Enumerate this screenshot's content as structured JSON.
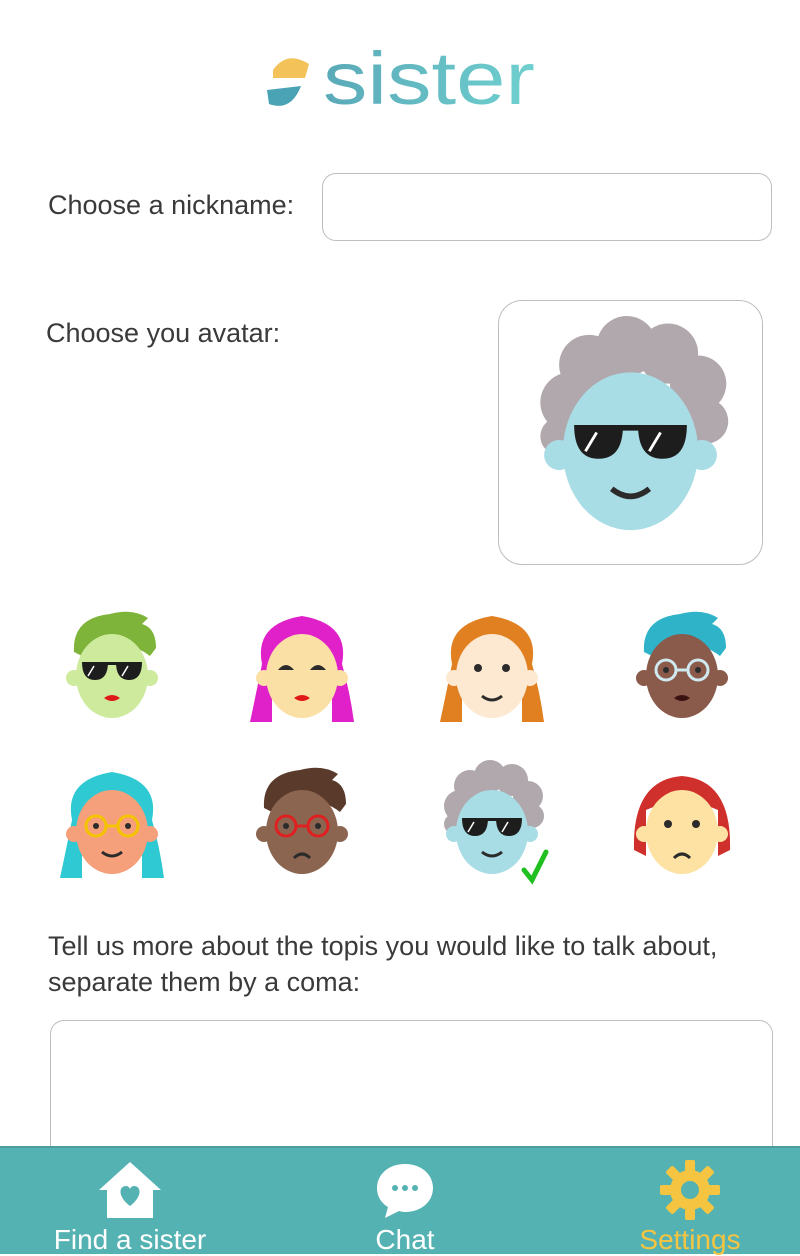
{
  "app": {
    "logo_text": "sister"
  },
  "form": {
    "nickname_label": "Choose a nickname:",
    "nickname_value": "",
    "avatar_label": "Choose you avatar:",
    "selected_avatar": "avatar-7",
    "topics_label": "Tell us more about the topis you would like to talk about, separate them by a coma:",
    "topics_value": ""
  },
  "avatars": [
    {
      "id": "avatar-1",
      "skin": "#cdea9d",
      "hair": "#7fb43a",
      "style": "short",
      "eyes": "sunglasses",
      "mouth": "lips"
    },
    {
      "id": "avatar-2",
      "skin": "#fbe0a6",
      "hair": "#e020c8",
      "style": "long",
      "eyes": "lashes",
      "mouth": "lips"
    },
    {
      "id": "avatar-3",
      "skin": "#fde8d2",
      "hair": "#e08020",
      "style": "long",
      "eyes": "dots",
      "mouth": "smile"
    },
    {
      "id": "avatar-4",
      "skin": "#8a5a4a",
      "hair": "#2fb3c9",
      "style": "short",
      "eyes": "glasses-light",
      "mouth": "lips-dark"
    },
    {
      "id": "avatar-5",
      "skin": "#f5a07a",
      "hair": "#2fc9d4",
      "style": "long",
      "eyes": "glasses-yellow",
      "mouth": "smile"
    },
    {
      "id": "avatar-6",
      "skin": "#8b6550",
      "hair": "#5a3a2a",
      "style": "short",
      "eyes": "glasses-red",
      "mouth": "frown"
    },
    {
      "id": "avatar-7",
      "skin": "#a9dde6",
      "hair": "#b0a8ad",
      "style": "curly",
      "eyes": "sunglasses",
      "mouth": "smile"
    },
    {
      "id": "avatar-8",
      "skin": "#fde2a3",
      "hair": "#d0302c",
      "style": "bob",
      "eyes": "dots",
      "mouth": "frown"
    }
  ],
  "nav": [
    {
      "label": "Find a sister",
      "icon": "home-heart-icon",
      "active": false
    },
    {
      "label": "Chat",
      "icon": "chat-bubble-icon",
      "active": false
    },
    {
      "label": "Settings",
      "icon": "gear-icon",
      "active": true
    }
  ],
  "colors": {
    "accent": "#55b2b2",
    "active": "#f5c542",
    "check": "#1fc01f"
  }
}
